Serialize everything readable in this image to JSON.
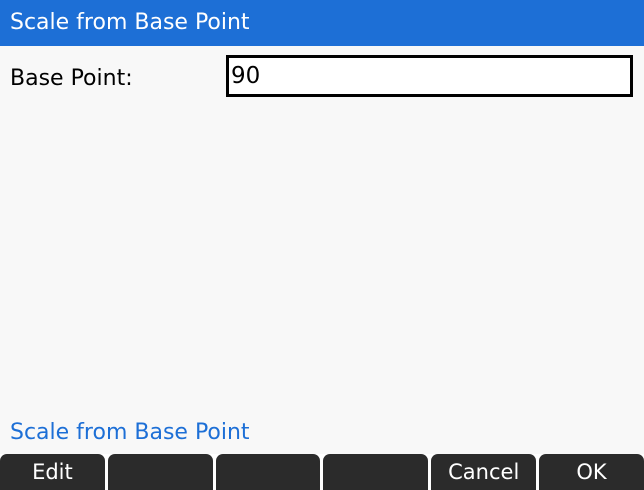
{
  "dialog": {
    "title": "Scale from Base Point",
    "help_text": "Scale from Base Point"
  },
  "field": {
    "label": "Base Point:",
    "value": "90"
  },
  "softkeys": [
    {
      "label": "Edit"
    },
    {
      "label": ""
    },
    {
      "label": ""
    },
    {
      "label": ""
    },
    {
      "label": "Cancel"
    },
    {
      "label": "OK"
    }
  ],
  "colors": {
    "title_bar": "#1d6fd6",
    "help_text": "#1d6fd6",
    "softkey_background": "#2b2b2b",
    "screen_background": "#f8f8f8"
  }
}
